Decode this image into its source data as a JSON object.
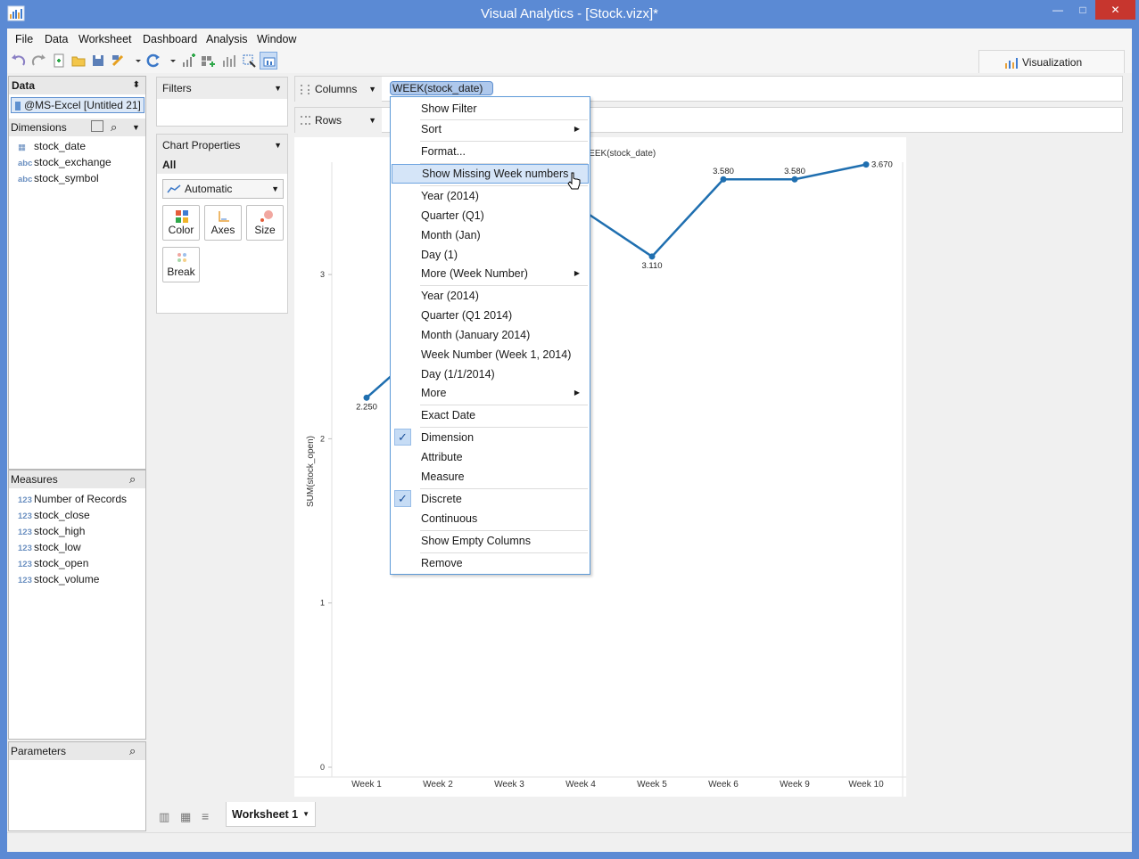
{
  "window": {
    "title": "Visual Analytics - [Stock.vizx]*",
    "minimize": "—",
    "maximize": "□",
    "close": "✕"
  },
  "menubar": [
    "File",
    "Data",
    "Worksheet",
    "Dashboard",
    "Analysis",
    "Window"
  ],
  "vis_tab": "Visualization",
  "data_panel": {
    "title": "Data",
    "connection": "@MS-Excel [Untitled 21]",
    "dimensions_title": "Dimensions",
    "dimensions": [
      {
        "type": "date",
        "name": "stock_date"
      },
      {
        "type": "abc",
        "name": "stock_exchange"
      },
      {
        "type": "abc",
        "name": "stock_symbol"
      }
    ],
    "measures_title": "Measures",
    "measures": [
      {
        "type": "123",
        "name": "Number of Records"
      },
      {
        "type": "123",
        "name": "stock_close"
      },
      {
        "type": "123",
        "name": "stock_high"
      },
      {
        "type": "123",
        "name": "stock_low"
      },
      {
        "type": "123",
        "name": "stock_open"
      },
      {
        "type": "123",
        "name": "stock_volume"
      }
    ],
    "parameters_title": "Parameters"
  },
  "filters": {
    "title": "Filters"
  },
  "chart_properties": {
    "title": "Chart Properties",
    "scope": "All",
    "mark_type": "Automatic",
    "buttons": [
      "Color",
      "Axes",
      "Size",
      "Break"
    ]
  },
  "shelves": {
    "columns_label": "Columns",
    "rows_label": "Rows",
    "column_pill": "WEEK(stock_date)"
  },
  "context_menu": {
    "items": [
      {
        "label": "Show Filter"
      },
      {
        "label": "Sort",
        "submenu": true
      },
      {
        "label": "Format..."
      },
      {
        "label": "Show Missing Week numbers",
        "highlighted": true
      },
      {
        "label": "Year (2014)"
      },
      {
        "label": "Quarter (Q1)"
      },
      {
        "label": "Month (Jan)"
      },
      {
        "label": "Day (1)"
      },
      {
        "label": "More (Week Number)",
        "submenu": true
      },
      {
        "label": "Year (2014)"
      },
      {
        "label": "Quarter (Q1 2014)"
      },
      {
        "label": "Month (January 2014)"
      },
      {
        "label": "Week Number (Week 1, 2014)"
      },
      {
        "label": "Day (1/1/2014)"
      },
      {
        "label": "More",
        "submenu": true
      },
      {
        "label": "Exact Date"
      },
      {
        "label": "Dimension",
        "checked": true
      },
      {
        "label": "Attribute"
      },
      {
        "label": "Measure"
      },
      {
        "label": "Discrete",
        "checked": true
      },
      {
        "label": "Continuous"
      },
      {
        "label": "Show Empty Columns"
      },
      {
        "label": "Remove"
      }
    ]
  },
  "chart_data": {
    "type": "line",
    "title": "WEEK(stock_date)",
    "ylabel": "SUM(stock_open)",
    "categories": [
      "Week 1",
      "Week 2",
      "Week 3",
      "Week 4",
      "Week 5",
      "Week 6",
      "Week 9",
      "Week 10"
    ],
    "values": [
      2.25,
      null,
      null,
      3.4,
      3.11,
      3.58,
      3.58,
      3.67
    ],
    "data_labels": [
      "2.250",
      "",
      "",
      "",
      "3.110",
      "3.580",
      "3.580",
      "3.670"
    ],
    "yticks": [
      "0",
      "1",
      "2",
      "3"
    ],
    "ylim": [
      0,
      3.7
    ],
    "color": "#1f6fb0",
    "grid": false
  },
  "sheet_tab": {
    "name": "Worksheet 1"
  }
}
